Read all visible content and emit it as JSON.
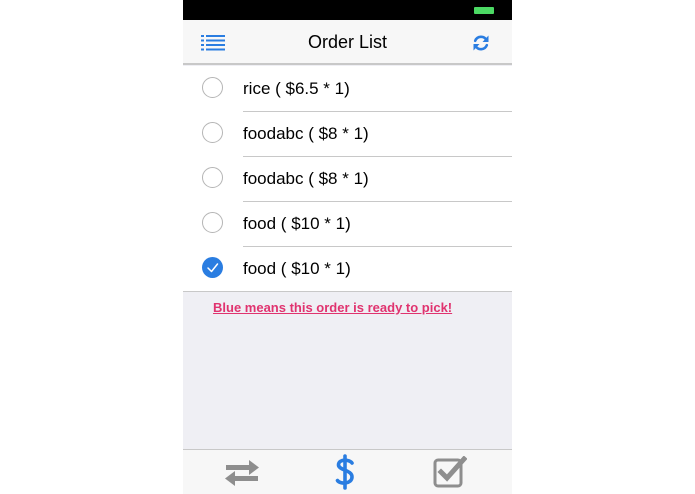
{
  "nav": {
    "title": "Order List"
  },
  "orders": [
    {
      "label": "rice ( $6.5 * 1)",
      "checked": false
    },
    {
      "label": "foodabc ( $8 * 1)",
      "checked": false
    },
    {
      "label": "foodabc ( $8 * 1)",
      "checked": false
    },
    {
      "label": "food ( $10 * 1)",
      "checked": false
    },
    {
      "label": "food ( $10 * 1)",
      "checked": true
    }
  ],
  "hint": "Blue means this order is ready to pick!",
  "tabs": [
    {
      "icon": "transfer-arrows-icon",
      "active": false
    },
    {
      "icon": "dollar-sign-icon",
      "active": true
    },
    {
      "icon": "checkbox-checked-icon",
      "active": false
    }
  ],
  "colors": {
    "accent": "#2a7de1",
    "hint": "#e0336f",
    "battery": "#4cd964",
    "tab_inactive": "#8e8e8e"
  }
}
